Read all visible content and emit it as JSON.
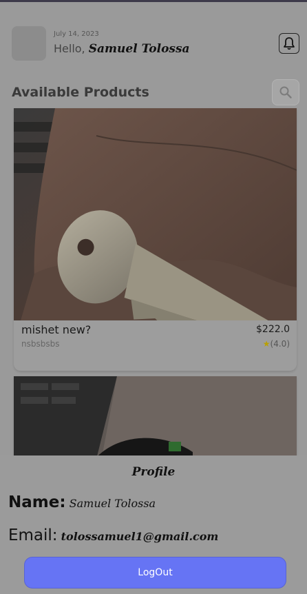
{
  "header": {
    "date": "July 14, 2023",
    "greeting": "Hello,",
    "user_name": "Samuel Tolossa"
  },
  "section": {
    "title": "Available Products"
  },
  "products": [
    {
      "name": "mishet new?",
      "description": "nsbsbsbs",
      "price": "$222.0",
      "rating": "(4.0)"
    },
    {
      "name": "",
      "description": "",
      "price": "",
      "rating": ""
    }
  ],
  "profile_sheet": {
    "title": "Profile",
    "name_label": "Name:",
    "name_value": "Samuel Tolossa",
    "email_label": "Email:",
    "email_value": "tolossamuel1@gmail.com",
    "logout_label": "LogOut"
  },
  "colors": {
    "accent": "#6674f4",
    "overlay": "#9a9a9a",
    "star": "#b9a000"
  },
  "icons": [
    "bell-icon",
    "search-icon",
    "star-icon"
  ]
}
